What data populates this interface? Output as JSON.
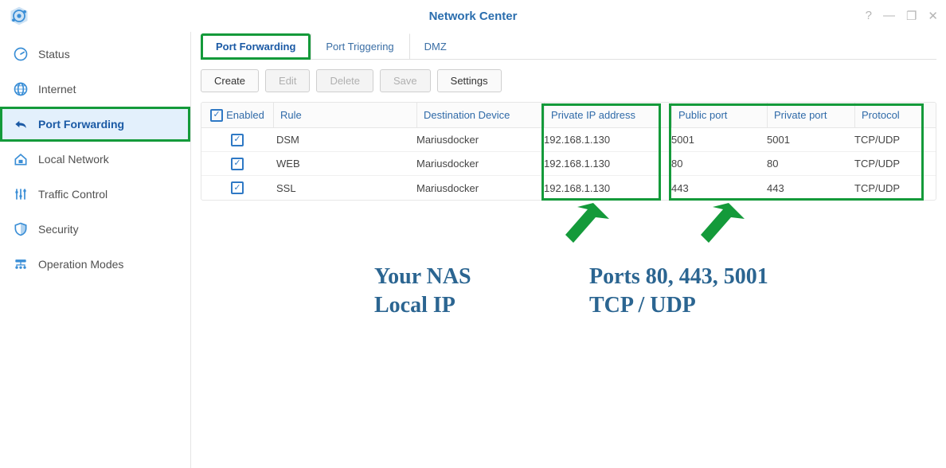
{
  "window": {
    "title": "Network Center",
    "controls_help": "?",
    "controls_min": "—",
    "controls_max": "❐",
    "controls_close": "✕"
  },
  "sidebar": {
    "items": [
      {
        "key": "status",
        "label": "Status"
      },
      {
        "key": "internet",
        "label": "Internet"
      },
      {
        "key": "port-forwarding",
        "label": "Port Forwarding",
        "active": true
      },
      {
        "key": "local-network",
        "label": "Local Network"
      },
      {
        "key": "traffic-control",
        "label": "Traffic Control"
      },
      {
        "key": "security",
        "label": "Security"
      },
      {
        "key": "operation-modes",
        "label": "Operation Modes"
      }
    ]
  },
  "tabs": {
    "items": [
      {
        "key": "port-fwd",
        "label": "Port Forwarding",
        "active": true
      },
      {
        "key": "port-trig",
        "label": "Port Triggering"
      },
      {
        "key": "dmz",
        "label": "DMZ"
      }
    ]
  },
  "toolbar": {
    "create": "Create",
    "edit": "Edit",
    "delete": "Delete",
    "save": "Save",
    "settings": "Settings"
  },
  "table": {
    "headers": {
      "enabled": "Enabled",
      "rule": "Rule",
      "destination": "Destination Device",
      "private_ip": "Private IP address",
      "public_port": "Public port",
      "private_port": "Private port",
      "protocol": "Protocol"
    },
    "rows": [
      {
        "enabled": true,
        "rule": "DSM",
        "destination": "Mariusdocker",
        "private_ip": "192.168.1.130",
        "public_port": "5001",
        "private_port": "5001",
        "protocol": "TCP/UDP"
      },
      {
        "enabled": true,
        "rule": "WEB",
        "destination": "Mariusdocker",
        "private_ip": "192.168.1.130",
        "public_port": "80",
        "private_port": "80",
        "protocol": "TCP/UDP"
      },
      {
        "enabled": true,
        "rule": "SSL",
        "destination": "Mariusdocker",
        "private_ip": "192.168.1.130",
        "public_port": "443",
        "private_port": "443",
        "protocol": "TCP/UDP"
      }
    ]
  },
  "annotations": {
    "ip": "Your NAS\nLocal IP",
    "ports": "Ports 80, 443, 5001\nTCP / UDP"
  }
}
